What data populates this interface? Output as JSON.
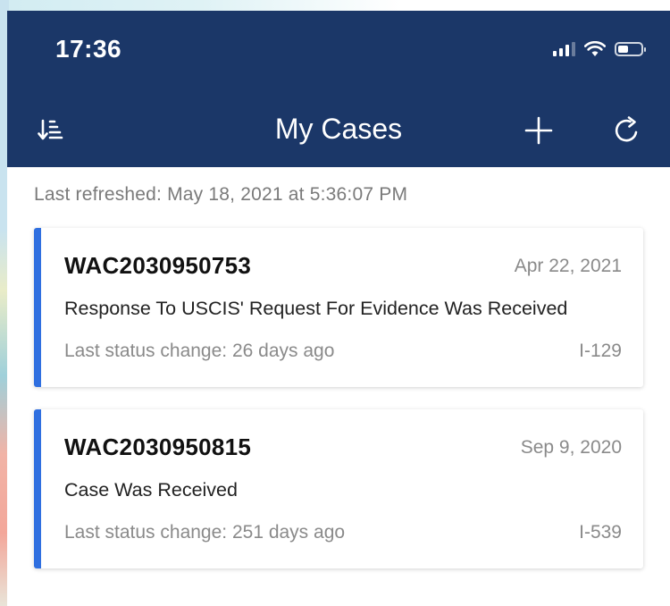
{
  "status_bar": {
    "time": "17:36"
  },
  "nav": {
    "title": "My Cases"
  },
  "refresh": {
    "text": "Last refreshed: May 18, 2021 at 5:36:07 PM"
  },
  "cases": [
    {
      "receipt": "WAC2030950753",
      "date": "Apr 22, 2021",
      "status": "Response To USCIS' Request For Evidence Was Received",
      "last_change": "Last status change: 26 days ago",
      "form": "I-129"
    },
    {
      "receipt": "WAC2030950815",
      "date": "Sep 9, 2020",
      "status": "Case Was Received",
      "last_change": "Last status change: 251 days ago",
      "form": "I-539"
    }
  ],
  "colors": {
    "navbar": "#1b3768",
    "accent": "#2f6fe0"
  },
  "icons": {
    "sort": "sort-icon",
    "add": "plus-icon",
    "refresh": "refresh-icon"
  }
}
